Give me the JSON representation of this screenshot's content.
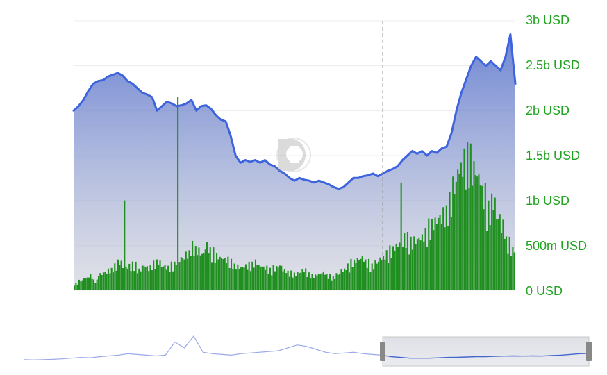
{
  "chart_data": {
    "type": "area",
    "y_axis": {
      "position": "right",
      "ticks": [
        "3b USD",
        "2.5b USD",
        "2b USD",
        "1.5b USD",
        "1b USD",
        "500m USD",
        "0 USD"
      ],
      "min": 0,
      "max": 3000000000,
      "tick_color": "#21a321"
    },
    "grid": true,
    "series": [
      {
        "kind": "area-line",
        "color": "#3d64dd",
        "values": [
          2.0,
          2.05,
          2.12,
          2.22,
          2.3,
          2.33,
          2.34,
          2.38,
          2.4,
          2.42,
          2.39,
          2.33,
          2.3,
          2.25,
          2.2,
          2.18,
          2.15,
          2.0,
          2.05,
          2.1,
          2.08,
          2.05,
          2.06,
          2.08,
          2.12,
          2.0,
          2.05,
          2.06,
          2.02,
          1.95,
          1.9,
          1.88,
          1.72,
          1.5,
          1.42,
          1.45,
          1.43,
          1.45,
          1.42,
          1.45,
          1.4,
          1.38,
          1.33,
          1.3,
          1.25,
          1.22,
          1.25,
          1.23,
          1.22,
          1.2,
          1.22,
          1.2,
          1.18,
          1.15,
          1.13,
          1.15,
          1.2,
          1.25,
          1.25,
          1.27,
          1.28,
          1.3,
          1.27,
          1.3,
          1.33,
          1.35,
          1.38,
          1.45,
          1.5,
          1.55,
          1.52,
          1.55,
          1.5,
          1.55,
          1.53,
          1.58,
          1.6,
          1.75,
          2.0,
          2.2,
          2.35,
          2.5,
          2.6,
          2.55,
          2.5,
          2.55,
          2.5,
          2.45,
          2.6,
          2.85,
          2.3
        ]
      },
      {
        "kind": "bar",
        "color": "#1f8f1f",
        "values": [
          0.08,
          0.12,
          0.15,
          0.18,
          0.12,
          0.2,
          0.22,
          0.25,
          0.3,
          0.35,
          0.28,
          0.3,
          0.32,
          0.25,
          0.3,
          0.28,
          0.33,
          0.35,
          0.3,
          0.28,
          0.32,
          0.38,
          0.4,
          0.45,
          0.55,
          0.5,
          0.45,
          0.55,
          0.48,
          0.42,
          0.4,
          0.38,
          0.35,
          0.3,
          0.28,
          0.3,
          0.32,
          0.35,
          0.3,
          0.28,
          0.25,
          0.28,
          0.3,
          0.25,
          0.22,
          0.2,
          0.22,
          0.25,
          0.2,
          0.18,
          0.2,
          0.22,
          0.18,
          0.16,
          0.2,
          0.25,
          0.3,
          0.35,
          0.38,
          0.4,
          0.35,
          0.3,
          0.35,
          0.4,
          0.45,
          0.5,
          0.55,
          0.6,
          0.65,
          0.6,
          0.62,
          0.65,
          0.7,
          0.8,
          0.85,
          0.9,
          0.95,
          1.1,
          1.3,
          1.5,
          1.6,
          1.65,
          1.5,
          1.4,
          1.2,
          1.0,
          1.1,
          0.9,
          0.8,
          0.6,
          0.5
        ],
        "spikes": [
          {
            "index": 10,
            "value": 1.0
          },
          {
            "index": 21,
            "value": 2.15
          },
          {
            "index": 67,
            "value": 1.2
          }
        ]
      }
    ],
    "crosshair": true,
    "navigator": {
      "series": [
        0.2,
        0.18,
        0.2,
        0.22,
        0.25,
        0.3,
        0.35,
        0.32,
        0.4,
        0.45,
        0.5,
        0.6,
        0.55,
        0.5,
        0.45,
        0.5,
        1.4,
        1.0,
        1.8,
        0.7,
        0.6,
        0.55,
        0.5,
        0.6,
        0.65,
        0.7,
        0.75,
        0.8,
        1.0,
        1.2,
        1.1,
        0.9,
        0.7,
        0.6,
        0.65,
        0.7,
        0.6,
        0.55,
        0.5,
        0.4,
        0.35,
        0.3,
        0.3,
        0.3,
        0.32,
        0.35,
        0.36,
        0.38,
        0.4,
        0.4,
        0.42,
        0.44,
        0.45,
        0.44,
        0.45,
        0.44,
        0.48,
        0.5,
        0.55,
        0.6,
        0.62
      ]
    }
  }
}
